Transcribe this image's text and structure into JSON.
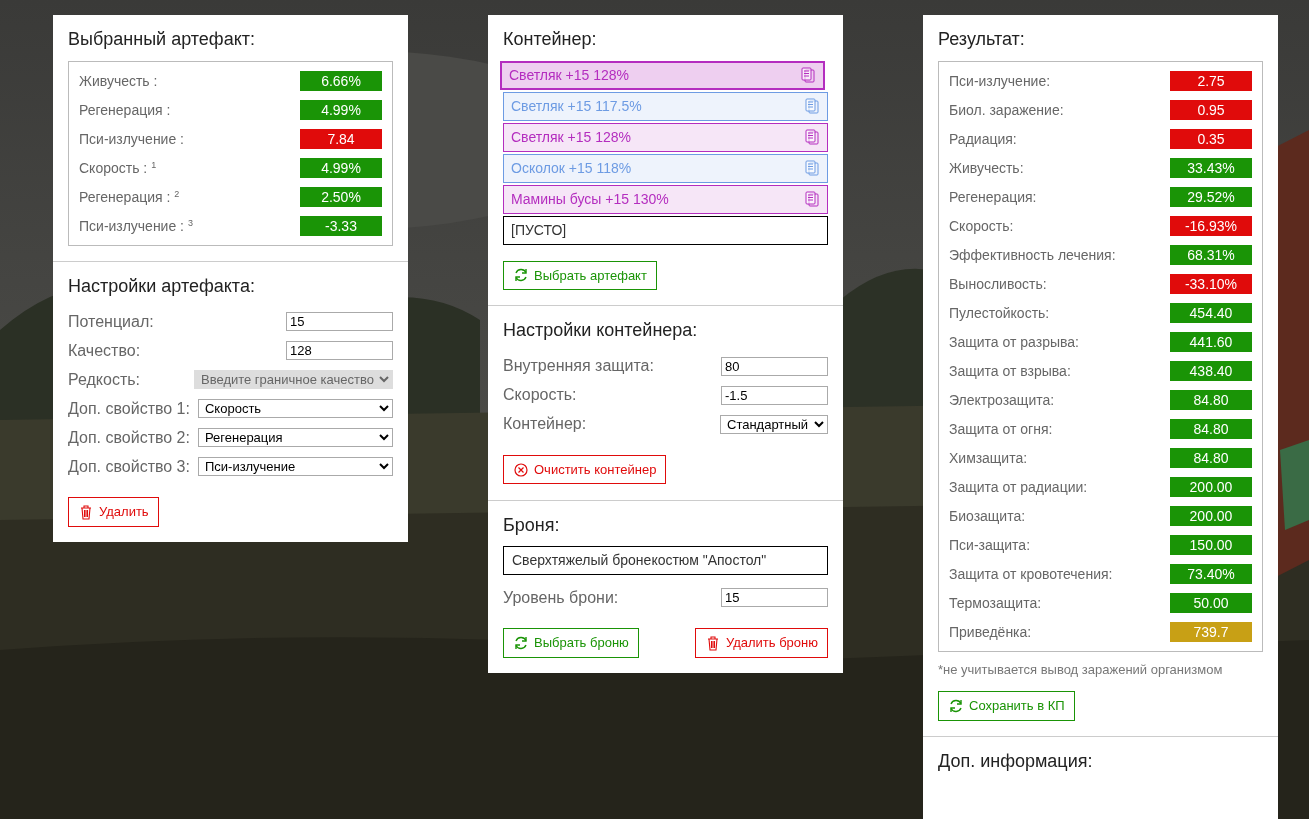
{
  "artifact": {
    "title": "Выбранный артефакт:",
    "stats": [
      {
        "label": "Живучесть :",
        "value": "6.66%",
        "color": "#1a9406"
      },
      {
        "label": "Регенерация :",
        "value": "4.99%",
        "color": "#1a9406"
      },
      {
        "label": "Пси-излучение :",
        "value": "7.84",
        "color": "#e00b0b"
      },
      {
        "label": "Скорость : $^{1}$",
        "value": "4.99%",
        "color": "#1a9406"
      },
      {
        "label": "Регенерация : $^{2}$",
        "value": "2.50%",
        "color": "#1a9406"
      },
      {
        "label": "Пси-излучение : $^{3}$",
        "value": "-3.33",
        "color": "#1a9406"
      }
    ]
  },
  "artifact_settings": {
    "title": "Настройки артефакта:",
    "fields": [
      {
        "kind": "input",
        "label": "Потенциал:",
        "value": "15",
        "disabled": false
      },
      {
        "kind": "input",
        "label": "Качество:",
        "value": "128",
        "disabled": false
      },
      {
        "kind": "select",
        "label": "Редкость:",
        "value": "Введите граничное качество",
        "disabled": true
      },
      {
        "kind": "select",
        "label": "Доп. свойство 1:",
        "value": "Скорость",
        "disabled": false
      },
      {
        "kind": "select",
        "label": "Доп. свойство 2:",
        "value": "Регенерация",
        "disabled": false
      },
      {
        "kind": "select",
        "label": "Доп. свойство 3:",
        "value": "Пси-излучение",
        "disabled": false
      }
    ],
    "delete_button": "Удалить"
  },
  "container": {
    "title": "Контейнер:",
    "slots": [
      {
        "kind": "artifact",
        "name": "Светляк +15 128%",
        "color": "#b42dbf",
        "selected": true
      },
      {
        "kind": "artifact",
        "name": "Светляк +15 117.5%",
        "color": "#6d9be3",
        "selected": false
      },
      {
        "kind": "artifact",
        "name": "Светляк +15 128%",
        "color": "#b42dbf",
        "selected": false
      },
      {
        "kind": "artifact",
        "name": "Осколок +15 118%",
        "color": "#6d9be3",
        "selected": false
      },
      {
        "kind": "artifact",
        "name": "Мамины бусы +15 130%",
        "color": "#b42dbf",
        "selected": false
      },
      {
        "kind": "empty",
        "name": "[ПУСТО]",
        "selected": false
      }
    ],
    "select_button": "Выбрать артефакт"
  },
  "container_settings": {
    "title": "Настройки контейнера:",
    "fields": [
      {
        "kind": "input",
        "label": "Внутренняя защита:",
        "value": "80",
        "disabled": false
      },
      {
        "kind": "input",
        "label": "Скорость:",
        "value": "-1.5",
        "disabled": false
      },
      {
        "kind": "select",
        "label": "Контейнер:",
        "value": "Стандартный",
        "disabled": false
      }
    ],
    "clear_button": "Очистить контейнер"
  },
  "armor": {
    "title": "Броня:",
    "name": "Сверхтяжелый бронекостюм \"Апостол\"",
    "fields": [
      {
        "kind": "input",
        "label": "Уровень брони:",
        "value": "15",
        "disabled": false
      }
    ],
    "select_button": "Выбрать броню",
    "delete_button": "Удалить броню"
  },
  "result": {
    "title": "Результат:",
    "stats": [
      {
        "label": "Пси-излучение:",
        "value": "2.75",
        "color": "#e00b0b"
      },
      {
        "label": "Биол. заражение:",
        "value": "0.95",
        "color": "#e00b0b"
      },
      {
        "label": "Радиация:",
        "value": "0.35",
        "color": "#e00b0b"
      },
      {
        "label": "Живучесть:",
        "value": "33.43%",
        "color": "#1a9406"
      },
      {
        "label": "Регенерация:",
        "value": "29.52%",
        "color": "#1a9406"
      },
      {
        "label": "Скорость:",
        "value": "-16.93%",
        "color": "#e00b0b"
      },
      {
        "label": "Эффективность лечения:",
        "value": "68.31%",
        "color": "#1a9406"
      },
      {
        "label": "Выносливость:",
        "value": "-33.10%",
        "color": "#e00b0b"
      },
      {
        "label": "Пулестойкость:",
        "value": "454.40",
        "color": "#1a9406"
      },
      {
        "label": "Защита от разрыва:",
        "value": "441.60",
        "color": "#1a9406"
      },
      {
        "label": "Защита от взрыва:",
        "value": "438.40",
        "color": "#1a9406"
      },
      {
        "label": "Электрозащита:",
        "value": "84.80",
        "color": "#1a9406"
      },
      {
        "label": "Защита от огня:",
        "value": "84.80",
        "color": "#1a9406"
      },
      {
        "label": "Химзащита:",
        "value": "84.80",
        "color": "#1a9406"
      },
      {
        "label": "Защита от радиации:",
        "value": "200.00",
        "color": "#1a9406"
      },
      {
        "label": "Биозащита:",
        "value": "200.00",
        "color": "#1a9406"
      },
      {
        "label": "Пси-защита:",
        "value": "150.00",
        "color": "#1a9406"
      },
      {
        "label": "Защита от кровотечения:",
        "value": "73.40%",
        "color": "#1a9406"
      },
      {
        "label": "Термозащита:",
        "value": "50.00",
        "color": "#1a9406"
      },
      {
        "label": "Приведёнка:",
        "value": "739.7",
        "color": "#c8a015"
      }
    ],
    "note": "*не учитывается вывод заражений организмом",
    "save_button": "Сохранить в КП"
  },
  "extra_info": {
    "title": "Доп. информация:"
  }
}
